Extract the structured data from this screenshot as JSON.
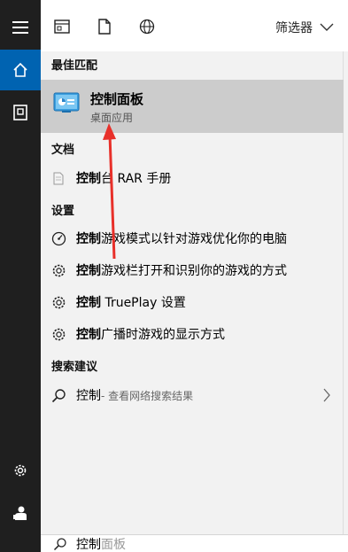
{
  "toolbar": {
    "filter_label": "筛选器",
    "icons": [
      "apps-icon",
      "document-icon",
      "globe-icon"
    ]
  },
  "sections": {
    "best_match": "最佳匹配",
    "documents": "文档",
    "settings": "设置",
    "search_suggestions": "搜索建议"
  },
  "best_match": {
    "title": "控制面板",
    "subtitle": "桌面应用"
  },
  "documents": [
    {
      "bold": "控制",
      "rest": "台 RAR 手册"
    }
  ],
  "settings": [
    {
      "bold": "控制",
      "rest": "游戏模式以针对游戏优化你的电脑",
      "icon": "gauge-icon"
    },
    {
      "bold": "控制",
      "rest": "游戏栏打开和识别你的游戏的方式",
      "icon": "gear-icon"
    },
    {
      "bold": "控制",
      "rest": " TruePlay 设置",
      "icon": "gear-icon"
    },
    {
      "bold": "控制",
      "rest": "广播时游戏的显示方式",
      "icon": "gear-icon"
    }
  ],
  "suggestion": {
    "bold": "控制",
    "rest": " - 查看网络搜索结果"
  },
  "searchbox": {
    "typed": "控制",
    "ghost": "面板"
  },
  "colors": {
    "rail": "#1f1f1f",
    "accent": "#0063b1",
    "selected": "#cccccc",
    "panel": "#f2f2f2",
    "arrow": "#e8302a"
  }
}
